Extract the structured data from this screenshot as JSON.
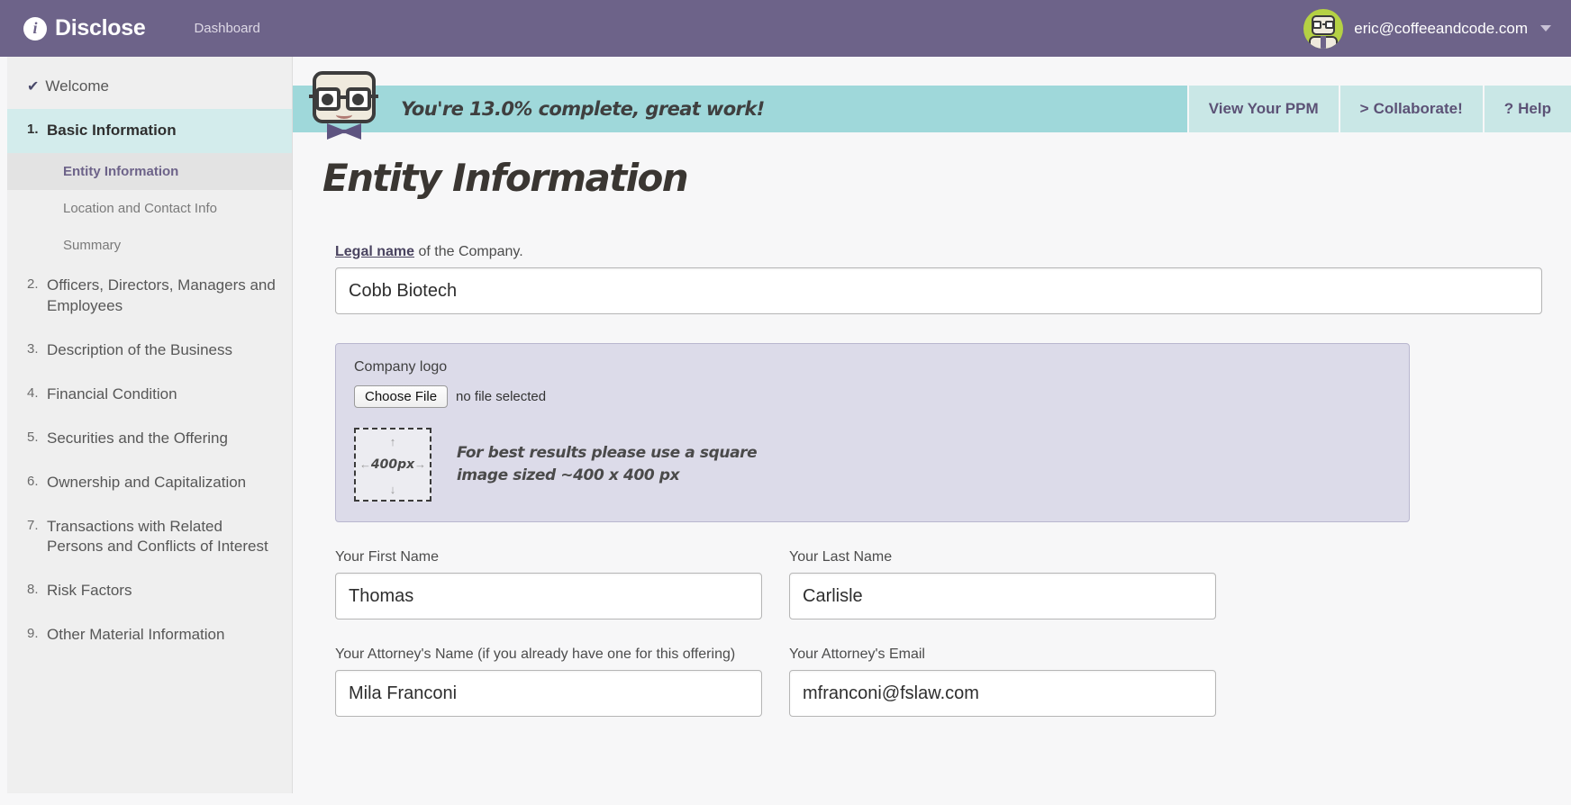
{
  "topnav": {
    "brand_icon": "info-circle-icon",
    "brand_name": "Disclose",
    "nav_link": "Dashboard",
    "user_email": "eric@coffeeandcode.com",
    "caret": "chevron-down-icon"
  },
  "sidebar": {
    "welcome": {
      "label": "Welcome",
      "icon": "check-icon"
    },
    "sections": [
      {
        "num": "1.",
        "label": "Basic Information",
        "active": true,
        "subitems": [
          {
            "label": "Entity Information",
            "active": true
          },
          {
            "label": "Location and Contact Info",
            "active": false
          },
          {
            "label": "Summary",
            "active": false
          }
        ]
      },
      {
        "num": "2.",
        "label": "Officers, Directors, Managers and Employees"
      },
      {
        "num": "3.",
        "label": "Description of the Business"
      },
      {
        "num": "4.",
        "label": "Financial Condition"
      },
      {
        "num": "5.",
        "label": "Securities and the Offering"
      },
      {
        "num": "6.",
        "label": "Ownership and Capitalization"
      },
      {
        "num": "7.",
        "label": "Transactions with Related Persons and Conflicts of Interest"
      },
      {
        "num": "8.",
        "label": "Risk Factors"
      },
      {
        "num": "9.",
        "label": "Other Material Information"
      }
    ]
  },
  "banner": {
    "progress_percent": "13.0%",
    "message": "You're 13.0% complete, great work!",
    "actions": [
      {
        "label": "View Your PPM",
        "icon": ""
      },
      {
        "label": "Collaborate!",
        "icon": ">"
      },
      {
        "label": "Help",
        "icon": "?"
      }
    ]
  },
  "main": {
    "title": "Entity Information",
    "legal_name": {
      "label_link": "Legal name",
      "label_rest": " of the Company.",
      "value": "Cobb Biotech"
    },
    "logo_panel": {
      "label": "Company logo",
      "choose_file_button": "Choose File",
      "file_status": "no file selected",
      "placeholder_size": "400px",
      "hint_line1": "For best results please use a square",
      "hint_line2": "image sized ~400 x 400 px"
    },
    "fields": {
      "first_name_label": "Your First Name",
      "first_name_value": "Thomas",
      "last_name_label": "Your Last Name",
      "last_name_value": "Carlisle",
      "attorney_name_label": "Your Attorney's Name (if you already have one for this offering)",
      "attorney_name_value": "Mila Franconi",
      "attorney_email_label": "Your Attorney's Email",
      "attorney_email_value": "mfranconi@fslaw.com"
    }
  },
  "colors": {
    "nav_purple": "#6d6389",
    "banner_teal": "#9fd8da",
    "banner_btn_teal": "#c9e7e6",
    "sidebar_gray": "#efefef",
    "active_section_teal": "#d3ecec",
    "logo_panel_lavender": "#dcdbe9",
    "avatar_green": "#b5d144"
  }
}
